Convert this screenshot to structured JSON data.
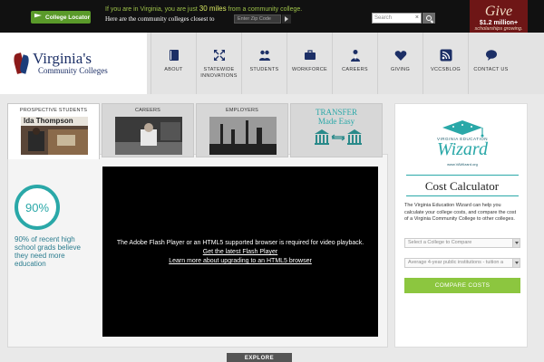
{
  "topbar": {
    "locator_label": "College Locator",
    "msg_prefix": "If you are in Virginia, you are just",
    "msg_miles": "30 miles",
    "msg_suffix": "from a community college.",
    "msg_line2": "Here are the community colleges closest to",
    "zip_placeholder": "Enter Zip Code",
    "search_placeholder": "Search",
    "search_clear": "×"
  },
  "give": {
    "word": "Give",
    "amount": "$1.2 million+",
    "sub": "scholarships growing."
  },
  "logo": {
    "line1": "Virginia's",
    "line2": "Community Colleges"
  },
  "nav": {
    "items": [
      {
        "label": "ABOUT",
        "icon": "book-icon"
      },
      {
        "label": "STATEWIDE INNOVATIONS",
        "icon": "expand-arrows-icon"
      },
      {
        "label": "STUDENTS",
        "icon": "people-icon"
      },
      {
        "label": "WORKFORCE",
        "icon": "briefcase-icon"
      },
      {
        "label": "CAREERS",
        "icon": "person-tie-icon"
      },
      {
        "label": "GIVING",
        "icon": "heart-icon"
      },
      {
        "label": "VCCSBLOG",
        "icon": "rss-icon"
      },
      {
        "label": "CONTACT US",
        "icon": "speech-bubble-icon"
      }
    ]
  },
  "tabs": [
    {
      "label": "PROSPECTIVE STUDENTS",
      "photo_caption": "Ida Thompson"
    },
    {
      "label": "CAREERS"
    },
    {
      "label": "EMPLOYERS"
    },
    {
      "label_line1": "TRANSFER",
      "label_line2": "Made Easy"
    }
  ],
  "stat": {
    "value": "90%",
    "description": "90% of recent high school grads believe they need more education"
  },
  "video": {
    "line1": "The Adobe Flash Player or an HTML5 supported browser is required for video playback.",
    "line2": "Get the latest Flash Player",
    "line3": "Learn more about upgrading to an HTML5 browser"
  },
  "explore_label": "EXPLORE",
  "calculator": {
    "wizard_small": "VIRGINIA EDUCATION",
    "wizard_title": "Wizard",
    "wizard_url": "www.VAWizard.org",
    "title": "Cost Calculator",
    "intro": "The Virginia Education Wizard can help you calculate your college costs, and compare the cost of a Virginia Community College to other colleges.",
    "select1": "Select a College to Compare",
    "select2": "Average 4-year public institutions - tuition a",
    "button": "COMPARE COSTS"
  },
  "colors": {
    "accent_green": "#8cc63f",
    "teal": "#2aa8a8",
    "give_red": "#6e1616",
    "navy": "#1c2f66"
  }
}
